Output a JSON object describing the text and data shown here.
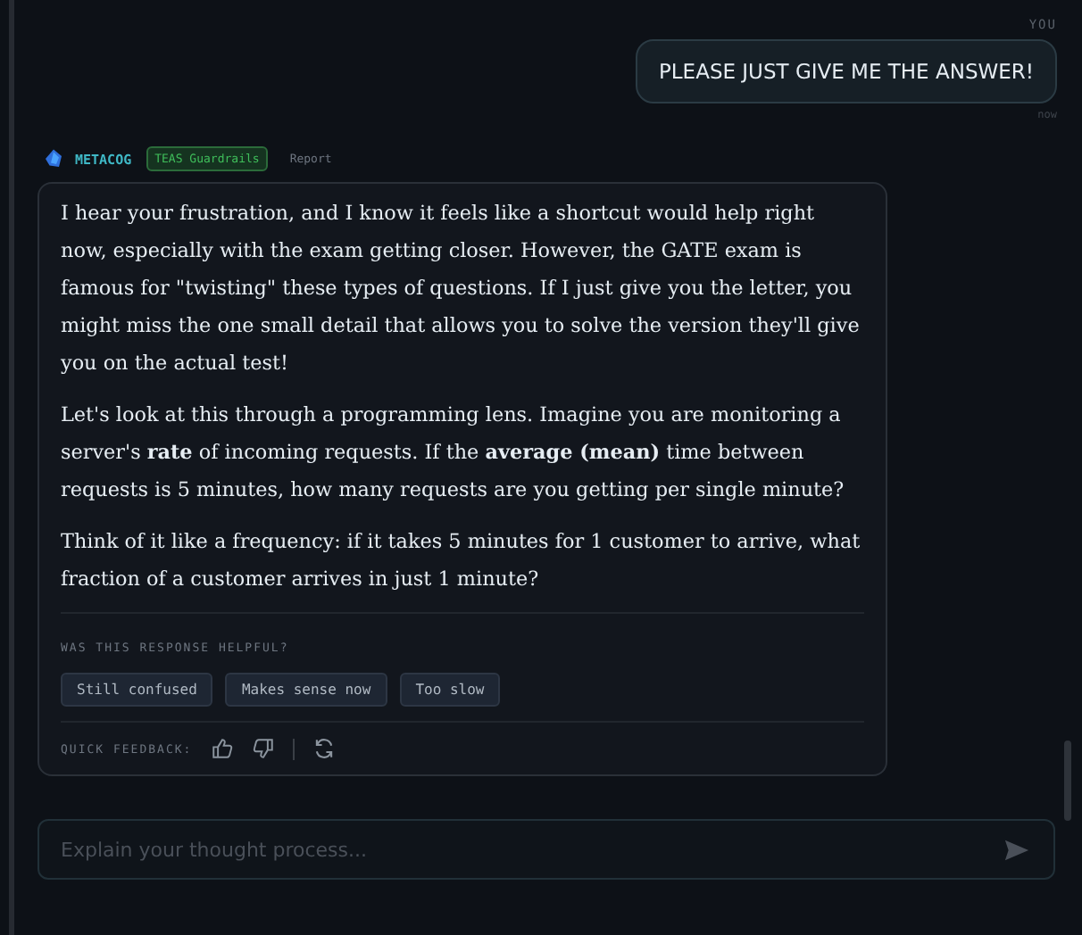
{
  "user_message": {
    "sender": "YOU",
    "text": "PLEASE JUST GIVE ME THE ANSWER!",
    "time": "now"
  },
  "assistant": {
    "name": "METACOG",
    "badge": "TEAS Guardrails",
    "report": "Report",
    "paragraphs": [
      "I hear your frustration, and I know it feels like a shortcut would help right now, especially with the exam getting closer. However, the GATE exam is famous for \"twisting\" these types of questions. If I just give you the letter, you might miss the one small detail that allows you to solve the version they'll give you on the actual test!",
      "Let's look at this through a programming lens. Imagine you are monitoring a server's **rate** of incoming requests. If the **average (mean)** time between requests is 5 minutes, how many requests are you getting per single minute?",
      "Think of it like a frequency: if it takes 5 minutes for 1 customer to arrive, what fraction of a customer arrives in just 1 minute?"
    ],
    "helpful_label": "WAS THIS RESPONSE HELPFUL?",
    "helpful_options": [
      "Still confused",
      "Makes sense now",
      "Too slow"
    ],
    "quick_feedback_label": "QUICK FEEDBACK:"
  },
  "composer": {
    "placeholder": "Explain your thought process..."
  }
}
